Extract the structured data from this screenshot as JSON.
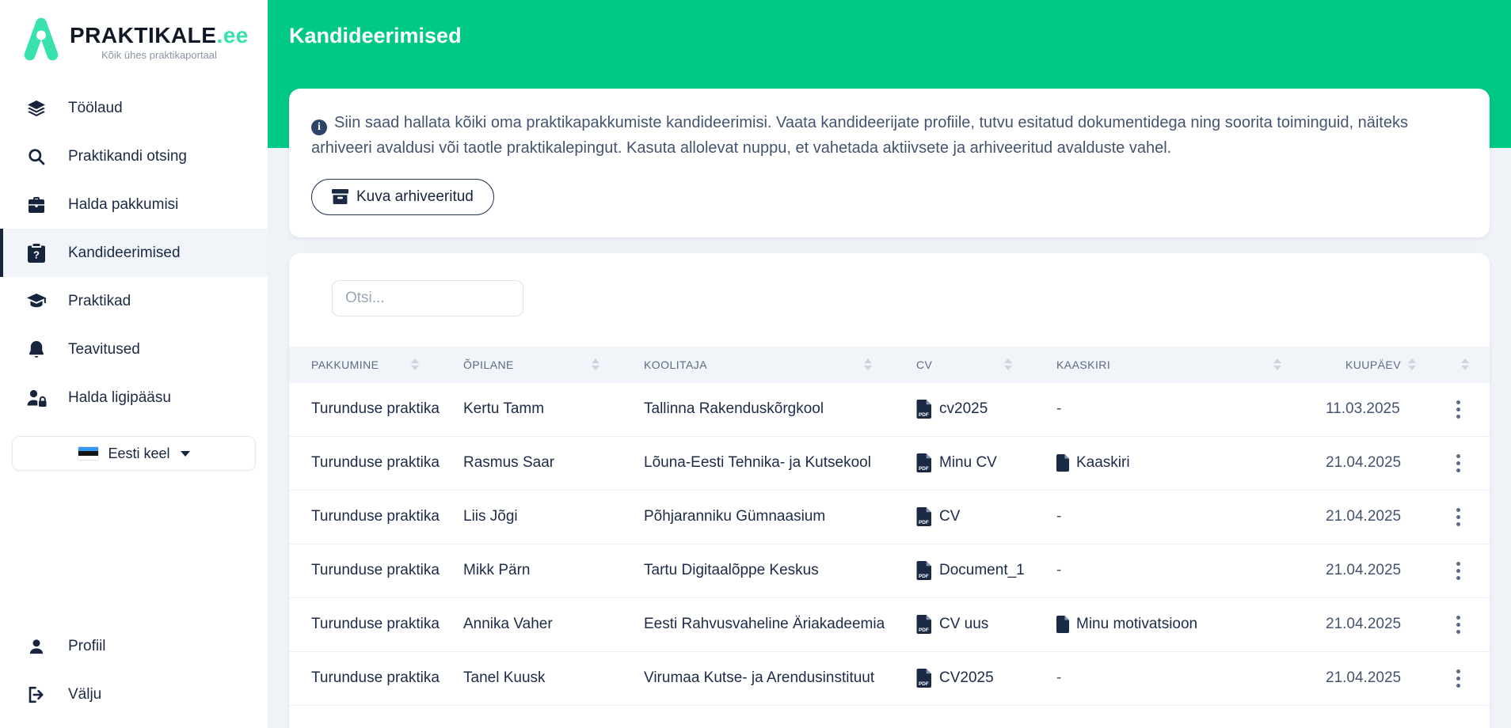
{
  "brand": {
    "name": "PRAKTIKALE",
    "tld": ".ee",
    "tagline": "Kõik ühes praktikaportaal",
    "logo_icon": "mountain-a-logo"
  },
  "colors": {
    "accent_green": "#00c885",
    "logo_teal": "#38e1ae",
    "navy": "#16243c",
    "page_bg": "#eff3f8"
  },
  "sidebar": {
    "items": [
      {
        "label": "Töölaud",
        "icon": "layers-icon",
        "active": false
      },
      {
        "label": "Praktikandi otsing",
        "icon": "search-icon",
        "active": false
      },
      {
        "label": "Halda pakkumisi",
        "icon": "briefcase-icon",
        "active": false
      },
      {
        "label": "Kandideerimised",
        "icon": "clipboard-question-icon",
        "active": true
      },
      {
        "label": "Praktikad",
        "icon": "graduation-cap-icon",
        "active": false
      },
      {
        "label": "Teavitused",
        "icon": "bell-icon",
        "active": false
      },
      {
        "label": "Halda ligipääsu",
        "icon": "user-lock-icon",
        "active": false
      }
    ],
    "language": {
      "label": "Eesti keel",
      "icon": "estonia-flag-icon",
      "flag_colors": [
        "#3598f2",
        "#141414",
        "#ffffff"
      ]
    },
    "footer_items": [
      {
        "label": "Profiil",
        "icon": "user-icon"
      },
      {
        "label": "Välju",
        "icon": "sign-out-icon"
      }
    ]
  },
  "header": {
    "title": "Kandideerimised"
  },
  "intro": {
    "info_icon": "info-circle-icon",
    "text": "Siin saad hallata kõiki oma praktikapakkumiste kandideerimisi. Vaata kandideerijate profiile, tutvu esitatud dokumentidega ning soorita toiminguid, näiteks arhiveeri avaldusi või taotle praktikalepingut. Kasuta allolevat nuppu, et vahetada aktiivsete ja arhiveeritud avalduste vahel.",
    "archive_button_label": "Kuva arhiveeritud",
    "archive_button_icon": "archive-box-icon"
  },
  "table": {
    "search_placeholder": "Otsi...",
    "columns": [
      "PAKKUMINE",
      "ÕPILANE",
      "KOOLITAJA",
      "CV",
      "KAASKIRI",
      "KUUPÄEV"
    ],
    "rows": [
      {
        "pakkumine": "Turunduse praktika",
        "opilane": "Kertu Tamm",
        "koolitaja": "Tallinna Rakenduskõrgkool",
        "cv": "cv2025",
        "kaaskiri": "-",
        "kuupaev": "11.03.2025"
      },
      {
        "pakkumine": "Turunduse praktika",
        "opilane": "Rasmus Saar",
        "koolitaja": "Lõuna-Eesti Tehnika- ja Kutsekool",
        "cv": "Minu CV",
        "kaaskiri": "Kaaskiri",
        "kuupaev": "21.04.2025"
      },
      {
        "pakkumine": "Turunduse praktika",
        "opilane": "Liis Jõgi",
        "koolitaja": "Põhjaranniku Gümnaasium",
        "cv": "CV",
        "kaaskiri": "-",
        "kuupaev": "21.04.2025"
      },
      {
        "pakkumine": "Turunduse praktika",
        "opilane": "Mikk Pärn",
        "koolitaja": "Tartu Digitaalõppe Keskus",
        "cv": "Document_1",
        "kaaskiri": "-",
        "kuupaev": "21.04.2025"
      },
      {
        "pakkumine": "Turunduse praktika",
        "opilane": "Annika Vaher",
        "koolitaja": "Eesti Rahvusvaheline Äriakadeemia",
        "cv": "CV uus",
        "kaaskiri": "Minu motivatsioon",
        "kuupaev": "21.04.2025"
      },
      {
        "pakkumine": "Turunduse praktika",
        "opilane": "Tanel Kuusk",
        "koolitaja": "Virumaa Kutse- ja Arendusinstituut",
        "cv": "CV2025",
        "kaaskiri": "-",
        "kuupaev": "21.04.2025"
      }
    ]
  }
}
